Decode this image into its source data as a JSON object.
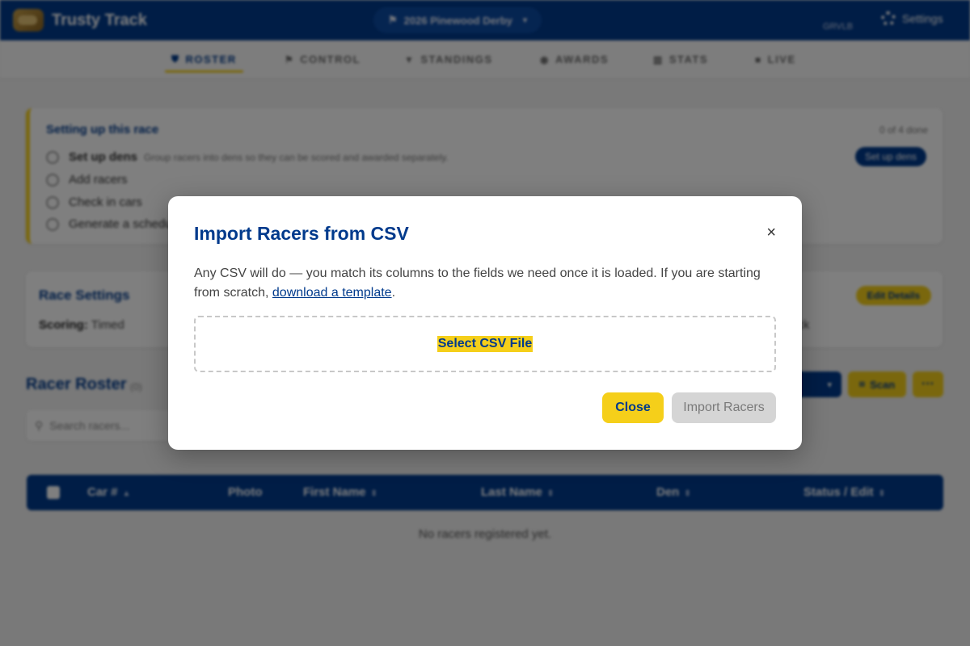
{
  "header": {
    "app_name": "Trusty Track",
    "race_selector": "2026 Pinewood Derby",
    "user": "GRVLB",
    "settings_label": "Settings"
  },
  "nav": {
    "tabs": [
      {
        "label": "ROSTER",
        "icon": "roster-icon"
      },
      {
        "label": "CONTROL",
        "icon": "flag-icon"
      },
      {
        "label": "STANDINGS",
        "icon": "trophy-icon"
      },
      {
        "label": "AWARDS",
        "icon": "medal-icon"
      },
      {
        "label": "STATS",
        "icon": "chart-icon"
      },
      {
        "label": "LIVE",
        "icon": "video-icon"
      }
    ],
    "active": "ROSTER"
  },
  "setup": {
    "title": "Setting up this race",
    "progress": "0 of 4 done",
    "steps": [
      {
        "label": "Set up dens",
        "desc": "Group racers into dens so they can be scored and awarded separately."
      },
      {
        "label": "Add racers"
      },
      {
        "label": "Check in cars"
      },
      {
        "label": "Generate a schedule"
      }
    ],
    "action_label": "Set up dens"
  },
  "race_settings": {
    "title": "Race Settings",
    "scoring_label": "Scoring:",
    "scoring_value": "Timed",
    "track_text": "ack",
    "edit_label": "Edit Details"
  },
  "roster": {
    "title": "Racer Roster",
    "count": "(0)",
    "search_placeholder": "Search racers...",
    "scan_label": "Scan",
    "more_label": "···",
    "columns": [
      "Car #",
      "Photo",
      "First Name",
      "Last Name",
      "Den",
      "Status / Edit"
    ],
    "empty_text": "No racers registered yet."
  },
  "modal": {
    "title": "Import Racers from CSV",
    "close_glyph": "×",
    "text_before_link": "Any CSV will do — you match its columns to the fields we need once it is loaded. If you are starting from scratch, ",
    "link_text": "download a template",
    "text_after_link": ".",
    "select_file_label": "Select CSV File",
    "close_button": "Close",
    "import_button": "Import Racers"
  },
  "colors": {
    "brand_blue": "#003a8c",
    "accent_yellow": "#f5cf1a",
    "disabled_grey": "#d5d5d5"
  }
}
